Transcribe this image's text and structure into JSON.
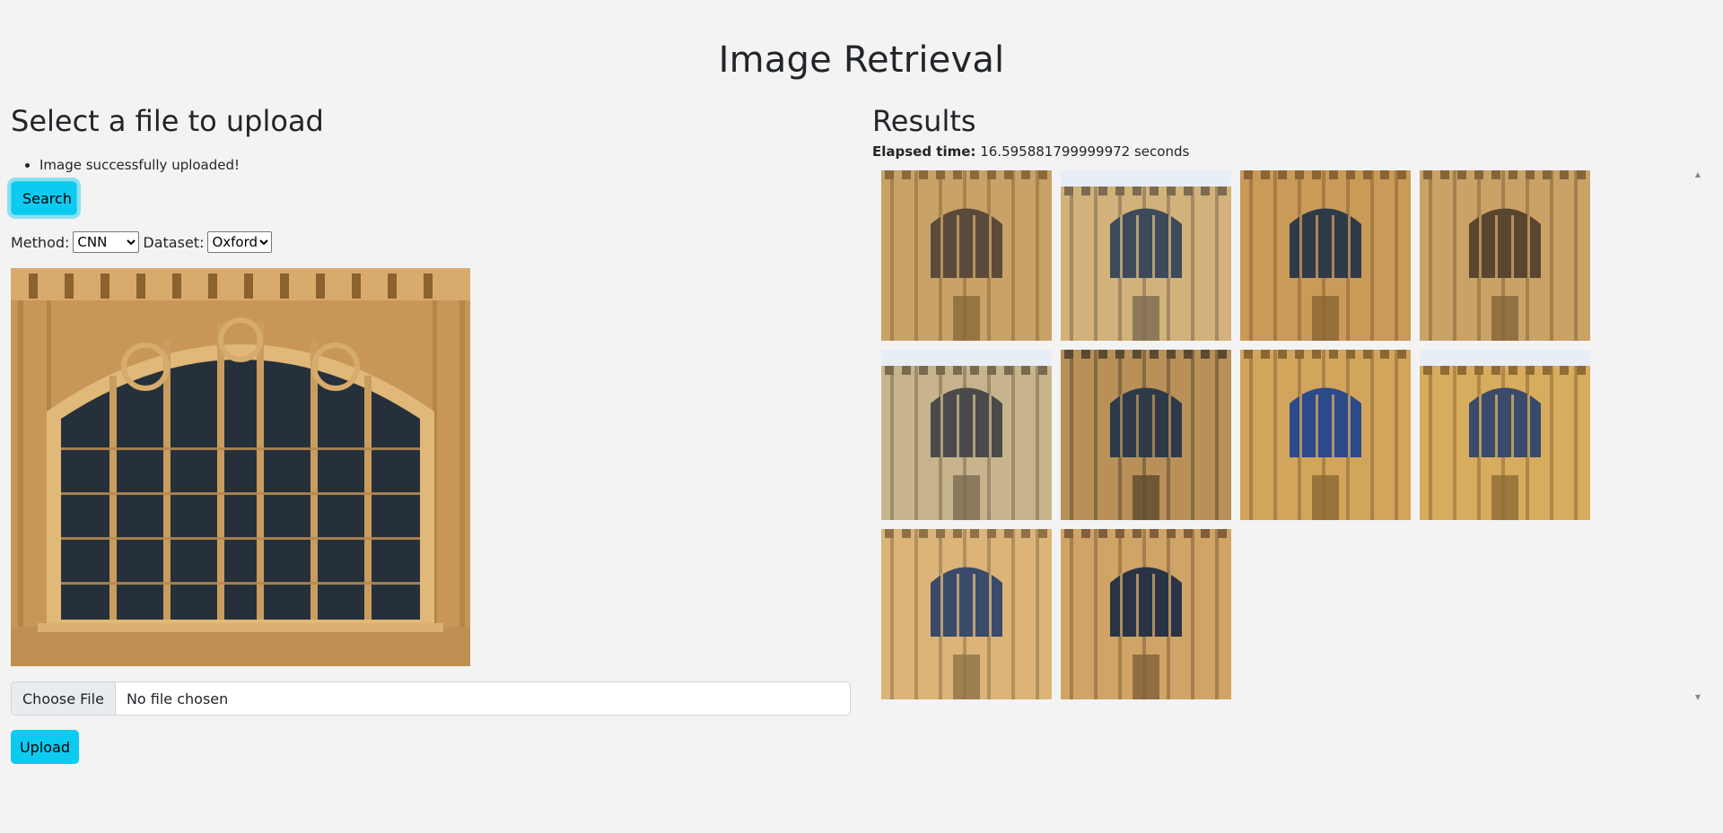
{
  "title": "Image Retrieval",
  "upload": {
    "heading": "Select a file to upload",
    "messages": [
      "Image successfully uploaded!"
    ],
    "search_label": "Search",
    "method_label": "Method:",
    "method_value": "CNN",
    "dataset_label": "Dataset:",
    "dataset_value": "Oxford",
    "choose_file_label": "Choose File",
    "no_file_text": "No file chosen",
    "upload_label": "Upload"
  },
  "results": {
    "heading": "Results",
    "elapsed_label": "Elapsed time:",
    "elapsed_value": "16.595881799999972 seconds",
    "count": 10
  },
  "colors": {
    "accent": "#0dcaf0",
    "background": "#f3f3f3",
    "stone": "#c9a05e"
  }
}
